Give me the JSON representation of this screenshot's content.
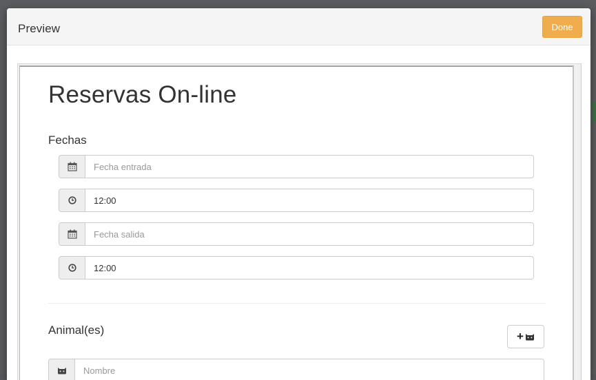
{
  "modal": {
    "title": "Preview",
    "done_label": "Done"
  },
  "form": {
    "title": "Reservas On-line",
    "fechas": {
      "title": "Fechas",
      "fecha_entrada": {
        "placeholder": "Fecha entrada",
        "icon": "calendar-icon"
      },
      "hora_entrada": {
        "value": "12:00",
        "icon": "clock-icon"
      },
      "fecha_salida": {
        "placeholder": "Fecha salida",
        "icon": "calendar-icon"
      },
      "hora_salida": {
        "value": "12:00",
        "icon": "clock-icon"
      }
    },
    "animales": {
      "title": "Animal(es)",
      "add_icons": [
        "plus-icon",
        "cat-icon"
      ],
      "nombre": {
        "placeholder": "Nombre",
        "icon": "cat-icon"
      }
    }
  },
  "colors": {
    "done_button": "#f0ad4e",
    "header_bg": "#f5f5f5",
    "addon_bg": "#eeeeee",
    "border": "#cccccc",
    "backdrop": "#5a5c5f"
  }
}
